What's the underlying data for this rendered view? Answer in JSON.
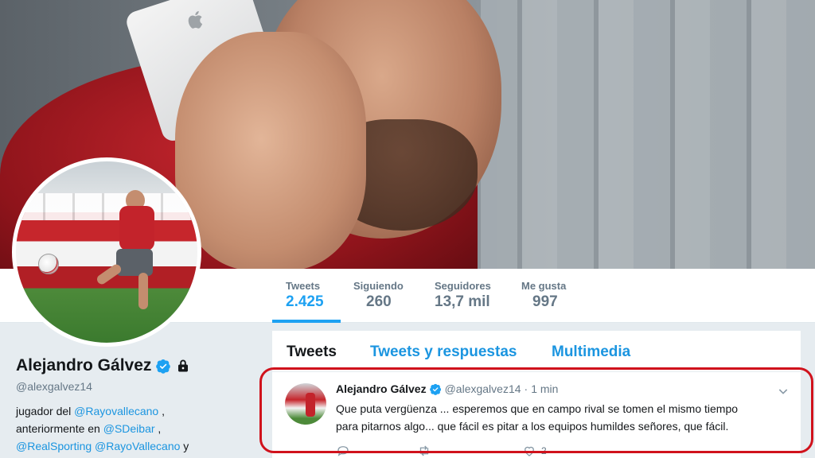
{
  "header": {
    "photo_alt": ""
  },
  "nav": {
    "stats": [
      {
        "label": "Tweets",
        "value": "2.425",
        "active": true
      },
      {
        "label": "Siguiendo",
        "value": "260",
        "active": false
      },
      {
        "label": "Seguidores",
        "value": "13,7 mil",
        "active": false
      },
      {
        "label": "Me gusta",
        "value": "997",
        "active": false
      }
    ]
  },
  "profile": {
    "name": "Alejandro Gálvez",
    "handle": "@alexgalvez14",
    "bio_line1_prefix": "jugador del ",
    "bio_link1": "@Rayovallecano",
    "bio_line1_suffix": " ,",
    "bio_line2_prefix": "anteriormente en ",
    "bio_link2": "@SDeibar",
    "bio_line2_suffix": " ,",
    "bio_link3": "@RealSporting",
    "bio_link4": "@RayoVallecano",
    "bio_line3_suffix": " y",
    "icons": [
      "verified-icon",
      "lock-icon"
    ]
  },
  "tabs": [
    {
      "label": "Tweets",
      "active": true
    },
    {
      "label": "Tweets y respuestas",
      "active": false
    },
    {
      "label": "Multimedia",
      "active": false
    }
  ],
  "tweet": {
    "author_name": "Alejandro Gálvez",
    "author_handle": "@alexgalvez14",
    "separator": "·",
    "time": "1 min",
    "text_line1": "Que puta vergüenza ... esperemos que en campo rival se tomen  el mismo tiempo",
    "text_line2": "para pitarnos algo... que fácil es pitar a los equipos humildes señores, que fácil.",
    "actions": [
      {
        "icon": "reply-icon",
        "count": ""
      },
      {
        "icon": "retweet-icon",
        "count": ""
      },
      {
        "icon": "like-icon",
        "count": "2"
      }
    ]
  },
  "colors": {
    "accent": "#1da1f2",
    "link": "#1b95e0",
    "highlight": "#d0121c",
    "muted": "#657786"
  }
}
